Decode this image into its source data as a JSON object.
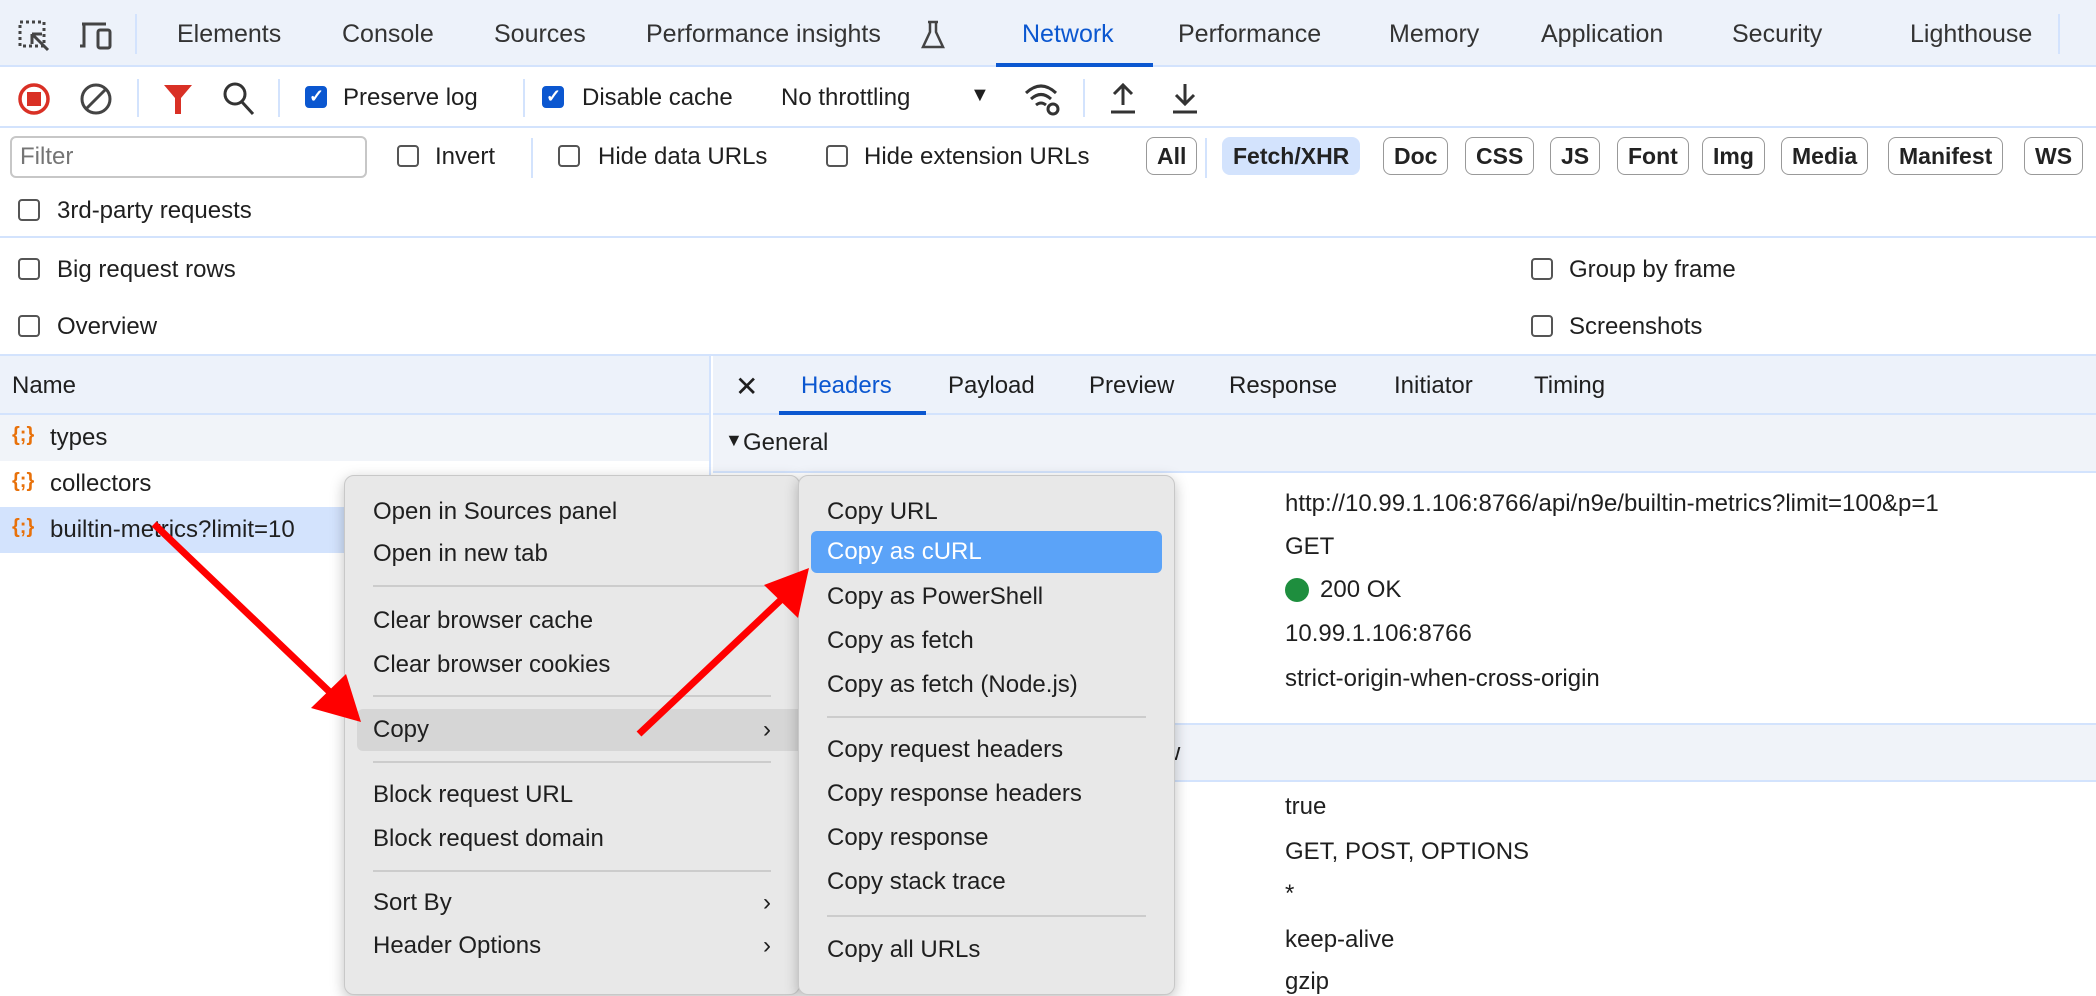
{
  "devtools_tabs": [
    "Elements",
    "Console",
    "Sources",
    "Performance insights",
    "Network",
    "Performance",
    "Memory",
    "Application",
    "Security",
    "Lighthouse"
  ],
  "active_tab": "Network",
  "toolbar": {
    "preserve_log": "Preserve log",
    "preserve_log_checked": true,
    "disable_cache": "Disable cache",
    "disable_cache_checked": true,
    "throttling": "No throttling"
  },
  "filter": {
    "placeholder": "Filter",
    "invert": "Invert",
    "hide_data_urls": "Hide data URLs",
    "hide_extension_urls": "Hide extension URLs",
    "types": [
      "All",
      "Fetch/XHR",
      "Doc",
      "CSS",
      "JS",
      "Font",
      "Img",
      "Media",
      "Manifest",
      "WS"
    ],
    "active_type": "Fetch/XHR",
    "third_party": "3rd-party requests"
  },
  "settings": {
    "big_rows": "Big request rows",
    "overview": "Overview",
    "group_by_frame": "Group by frame",
    "screenshots": "Screenshots"
  },
  "requests": {
    "header": "Name",
    "items": [
      "types",
      "collectors",
      "builtin-metrics?limit=10"
    ],
    "selected": 2
  },
  "detail": {
    "tabs": [
      "Headers",
      "Payload",
      "Preview",
      "Response",
      "Initiator",
      "Timing"
    ],
    "active": "Headers",
    "general_title": "General",
    "general_values": [
      "http://10.99.1.106:8766/api/n9e/builtin-metrics?limit=100&p=1",
      "GET",
      "200 OK",
      "10.99.1.106:8766",
      "strict-origin-when-cross-origin"
    ],
    "section2_fragment": "w",
    "response_values": [
      "true",
      "GET, POST, OPTIONS",
      "*",
      "keep-alive",
      "gzip"
    ],
    "status_color": "#1e8e3e"
  },
  "context_menu": {
    "items": [
      "Open in Sources panel",
      "Open in new tab",
      "Clear browser cache",
      "Clear browser cookies",
      "Copy",
      "Block request URL",
      "Block request domain",
      "Sort By",
      "Header Options"
    ]
  },
  "copy_submenu": {
    "items": [
      "Copy URL",
      "Copy as cURL",
      "Copy as PowerShell",
      "Copy as fetch",
      "Copy as fetch (Node.js)",
      "Copy request headers",
      "Copy response headers",
      "Copy response",
      "Copy stack trace",
      "Copy all URLs"
    ],
    "highlighted": "Copy as cURL"
  },
  "colors": {
    "accent": "#0b57d0",
    "highlight": "#5ba3f8",
    "annotation_arrow": "#ff0000",
    "record": "#d93025"
  }
}
